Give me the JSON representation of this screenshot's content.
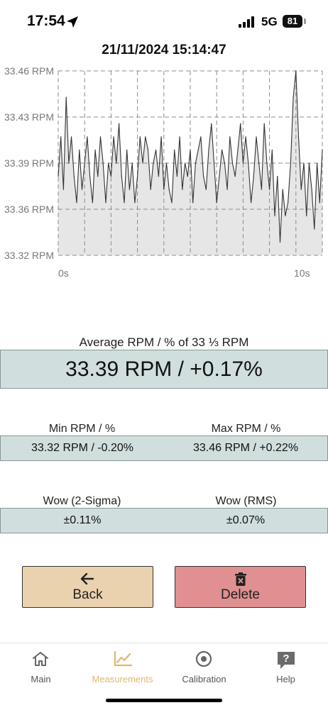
{
  "status_bar": {
    "time": "17:54",
    "network": "5G",
    "battery": "81"
  },
  "chart": {
    "title": "21/11/2024 15:14:47"
  },
  "chart_data": {
    "type": "area",
    "title": "21/11/2024 15:14:47",
    "x_tick_labels": [
      "0s",
      "10s"
    ],
    "y_tick_labels": [
      "33.46 RPM",
      "33.43 RPM",
      "33.39 RPM",
      "33.36 RPM",
      "33.32 RPM"
    ],
    "ylim": [
      33.32,
      33.46
    ],
    "xlim": [
      0,
      10
    ],
    "grid": true,
    "x": [
      0,
      0.1,
      0.2,
      0.3,
      0.4,
      0.5,
      0.6,
      0.7,
      0.8,
      0.9,
      1,
      1.1,
      1.2,
      1.3,
      1.4,
      1.5,
      1.6,
      1.7,
      1.8,
      1.9,
      2,
      2.1,
      2.2,
      2.3,
      2.4,
      2.5,
      2.6,
      2.7,
      2.8,
      2.9,
      3,
      3.1,
      3.2,
      3.3,
      3.4,
      3.5,
      3.6,
      3.7,
      3.8,
      3.9,
      4,
      4.1,
      4.2,
      4.3,
      4.4,
      4.5,
      4.6,
      4.7,
      4.8,
      4.9,
      5,
      5.1,
      5.2,
      5.3,
      5.4,
      5.5,
      5.6,
      5.7,
      5.8,
      5.9,
      6,
      6.1,
      6.2,
      6.3,
      6.4,
      6.5,
      6.6,
      6.7,
      6.8,
      6.9,
      7,
      7.1,
      7.2,
      7.3,
      7.4,
      7.5,
      7.6,
      7.7,
      7.8,
      7.9,
      8,
      8.1,
      8.2,
      8.3,
      8.4,
      8.5,
      8.6,
      8.7,
      8.8,
      8.9,
      9,
      9.1,
      9.2,
      9.3,
      9.4,
      9.5,
      9.6,
      9.7,
      9.8,
      9.9,
      10
    ],
    "series": [
      {
        "values": [
          33.38,
          33.41,
          33.37,
          33.44,
          33.39,
          33.41,
          33.38,
          33.36,
          33.4,
          33.37,
          33.39,
          33.41,
          33.38,
          33.36,
          33.4,
          33.38,
          33.41,
          33.39,
          33.36,
          33.39,
          33.38,
          33.41,
          33.39,
          33.42,
          33.38,
          33.36,
          33.4,
          33.37,
          33.39,
          33.36,
          33.38,
          33.41,
          33.39,
          33.41,
          33.4,
          33.37,
          33.39,
          33.4,
          33.38,
          33.41,
          33.37,
          33.39,
          33.37,
          33.36,
          33.4,
          33.38,
          33.41,
          33.37,
          33.39,
          33.38,
          33.4,
          33.36,
          33.39,
          33.4,
          33.41,
          33.38,
          33.37,
          33.4,
          33.42,
          33.39,
          33.36,
          33.38,
          33.4,
          33.39,
          33.37,
          33.41,
          33.39,
          33.38,
          33.4,
          33.42,
          33.39,
          33.41,
          33.39,
          33.36,
          33.38,
          33.41,
          33.39,
          33.37,
          33.42,
          33.39,
          33.37,
          33.4,
          33.35,
          33.38,
          33.33,
          33.37,
          33.35,
          33.36,
          33.39,
          33.44,
          33.46,
          33.41,
          33.37,
          33.39,
          33.35,
          33.39,
          33.37,
          33.34,
          33.39,
          33.36,
          33.4
        ]
      }
    ]
  },
  "average": {
    "label": "Average RPM / % of 33 ⅓ RPM",
    "value": "33.39 RPM / +0.17%"
  },
  "min": {
    "label": "Min RPM / %",
    "value": "33.32 RPM / -0.20%"
  },
  "max": {
    "label": "Max RPM / %",
    "value": "33.46 RPM / +0.22%"
  },
  "wow_sigma": {
    "label": "Wow (2-Sigma)",
    "value": "±0.11%"
  },
  "wow_rms": {
    "label": "Wow (RMS)",
    "value": "±0.07%"
  },
  "buttons": {
    "back": "Back",
    "delete": "Delete"
  },
  "colors": {
    "accent": "#e3b66d",
    "back_button": "#ebd2ae",
    "delete_button": "#e09090",
    "stat_box": "#d1dede",
    "chart_fill": "#e6e6e6"
  },
  "tabs": [
    {
      "label": "Main",
      "icon": "home-icon",
      "active": false
    },
    {
      "label": "Measurements",
      "icon": "chart-line-icon",
      "active": true
    },
    {
      "label": "Calibration",
      "icon": "target-icon",
      "active": false
    },
    {
      "label": "Help",
      "icon": "help-icon",
      "active": false
    }
  ]
}
